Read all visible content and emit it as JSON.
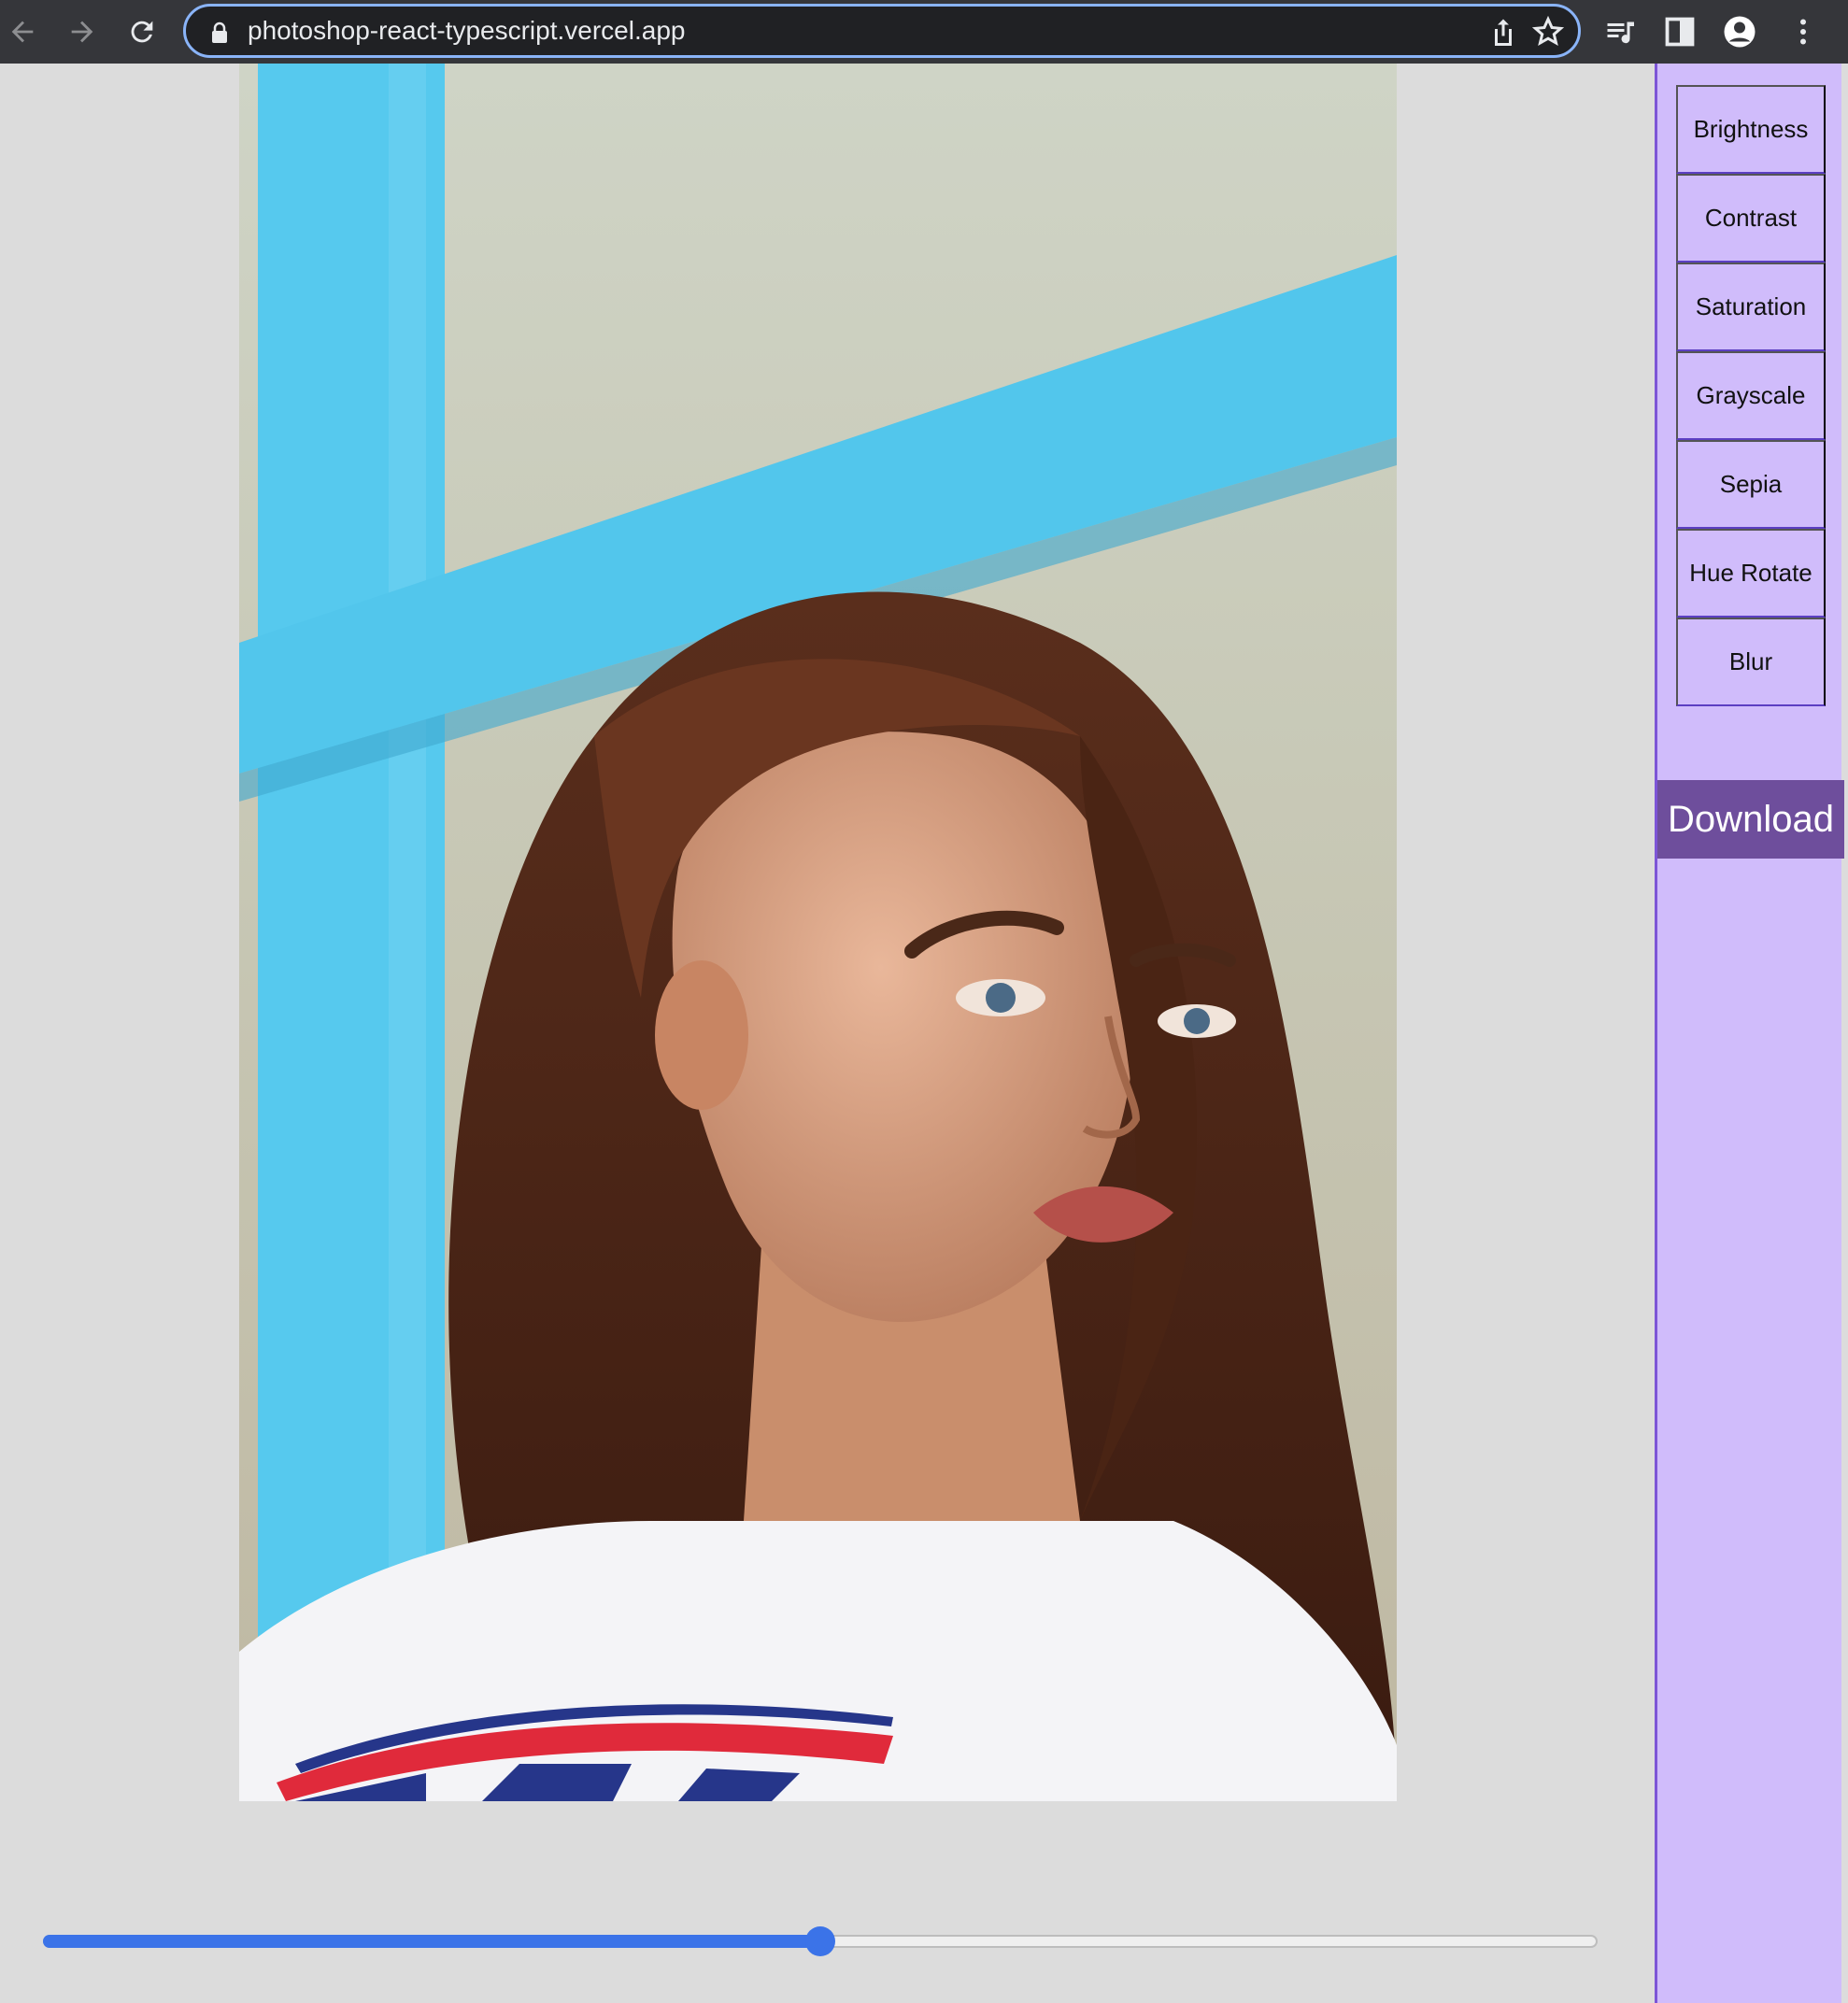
{
  "browser": {
    "url": "photoshop-react-typescript.vercel.app",
    "icons": {
      "back": "arrow-left-icon",
      "forward": "arrow-right-icon",
      "reload": "reload-icon",
      "lock": "lock-icon",
      "share": "share-icon",
      "bookmark": "star-icon",
      "media": "media-control-icon",
      "side_panel": "side-panel-icon",
      "profile": "profile-icon",
      "menu": "kebab-menu-icon"
    }
  },
  "image": {
    "subject": "portrait-photo"
  },
  "slider": {
    "value_fraction": 0.5
  },
  "sidebar": {
    "items": [
      {
        "label": "Brightness"
      },
      {
        "label": "Contrast"
      },
      {
        "label": "Saturation"
      },
      {
        "label": "Grayscale"
      },
      {
        "label": "Sepia"
      },
      {
        "label": "Hue Rotate"
      },
      {
        "label": "Blur"
      }
    ],
    "download_label": "Download"
  },
  "colors": {
    "page_background": "#dcdcdc",
    "sidebar_background": "#d0bcfb",
    "sidebar_border": "#7d55d6",
    "divider": "#5c3fc2",
    "download_background": "#6e4e9c",
    "slider_accent": "#3b73e8",
    "chrome_background": "#35363a"
  }
}
